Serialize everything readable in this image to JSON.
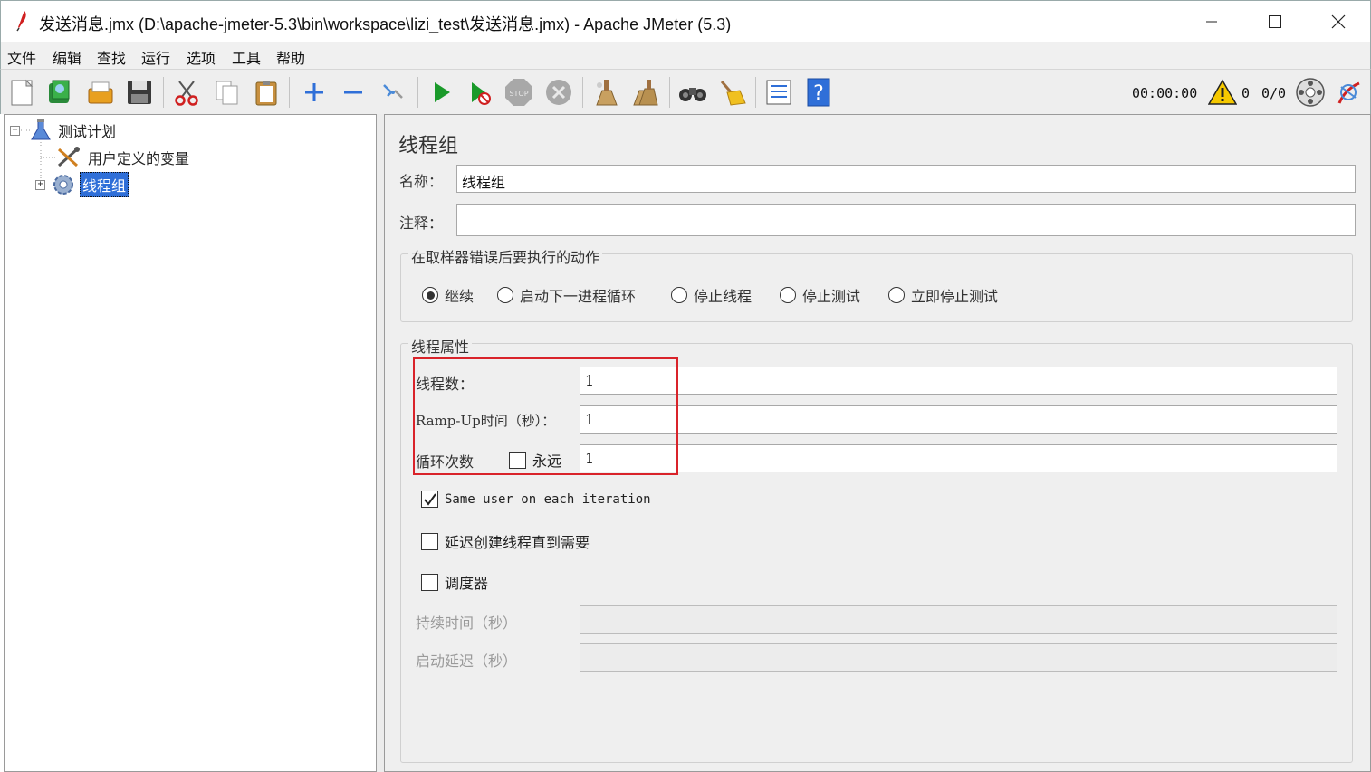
{
  "window": {
    "title": "发送消息.jmx (D:\\apache-jmeter-5.3\\bin\\workspace\\lizi_test\\发送消息.jmx) - Apache JMeter (5.3)"
  },
  "menu": [
    "文件",
    "编辑",
    "查找",
    "运行",
    "选项",
    "工具",
    "帮助"
  ],
  "toolbar": {
    "timer": "00:00:00",
    "warning_count": "0",
    "thread_ratio": "0/0",
    "icons": [
      "new-icon",
      "templates-icon",
      "open-icon",
      "save-icon",
      "cut-icon",
      "copy-icon",
      "paste-icon",
      "expand-icon",
      "collapse-icon",
      "toggle-icon",
      "start-icon",
      "start-no-pause-icon",
      "stop-icon",
      "shutdown-icon",
      "clear-icon",
      "clear-all-icon",
      "search-icon",
      "reset-search-icon",
      "function-helper-icon",
      "help-icon",
      "remote-icon",
      "logo-icon"
    ]
  },
  "tree": {
    "root": "测试计划",
    "children": [
      "用户定义的变量",
      "线程组"
    ],
    "selected": "线程组"
  },
  "panel": {
    "title": "线程组",
    "name_label": "名称：",
    "name_value": "线程组",
    "comment_label": "注释：",
    "comment_value": "",
    "error_group": {
      "title": "在取样器错误后要执行的动作",
      "options": [
        "继续",
        "启动下一进程循环",
        "停止线程",
        "停止测试",
        "立即停止测试"
      ],
      "selected": "继续"
    },
    "thread_group": {
      "title": "线程属性",
      "threads_label": "线程数：",
      "threads_value": "1",
      "rampup_label": "Ramp-Up时间（秒）：",
      "rampup_value": "1",
      "loop_label": "循环次数",
      "forever_label": "永远",
      "forever_checked": false,
      "loop_value": "1",
      "same_user_label": "Same user on each iteration",
      "same_user_checked": true,
      "delay_create_label": "延迟创建线程直到需要",
      "delay_create_checked": false,
      "scheduler_label": "调度器",
      "scheduler_checked": false,
      "duration_label": "持续时间（秒）",
      "duration_value": "",
      "startup_delay_label": "启动延迟（秒）",
      "startup_delay_value": ""
    }
  },
  "colors": {
    "highlight_box": "#d9232a",
    "selection": "#2f6fd8",
    "panel_bg": "#efefef"
  }
}
